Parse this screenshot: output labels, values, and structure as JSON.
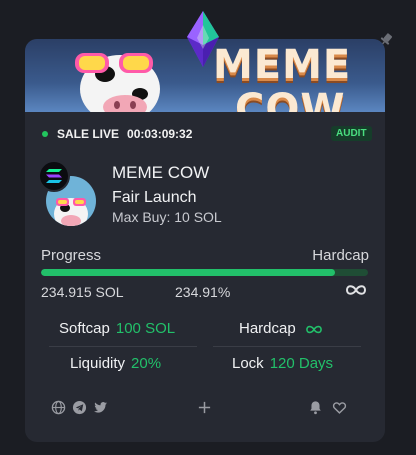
{
  "banner": {
    "line1": "MEME",
    "line2": "COW"
  },
  "status": {
    "label": "SALE LIVE",
    "timer": "00:03:09:32",
    "badge": "AUDIT"
  },
  "project": {
    "name": "MEME COW",
    "launch_type": "Fair Launch",
    "max_buy": "Max Buy: 10 SOL"
  },
  "progress": {
    "label": "Progress",
    "hardcap_label": "Hardcap",
    "raised": "234.915 SOL",
    "percent_text": "234.91%",
    "fill_fraction": 1.0
  },
  "stats": {
    "softcap_label": "Softcap",
    "softcap_value": "100 SOL",
    "hardcap_label": "Hardcap",
    "liquidity_label": "Liquidity",
    "liquidity_value": "20%",
    "lock_label": "Lock",
    "lock_value": "120 Days"
  },
  "colors": {
    "accent": "#22c06a",
    "card": "#262932",
    "background": "#1b1d23"
  },
  "icons": [
    "pin-icon",
    "diamond-logo-icon",
    "solana-icon",
    "infinity-icon",
    "globe-icon",
    "telegram-icon",
    "twitter-icon",
    "plus-icon",
    "bell-icon",
    "heart-icon"
  ]
}
